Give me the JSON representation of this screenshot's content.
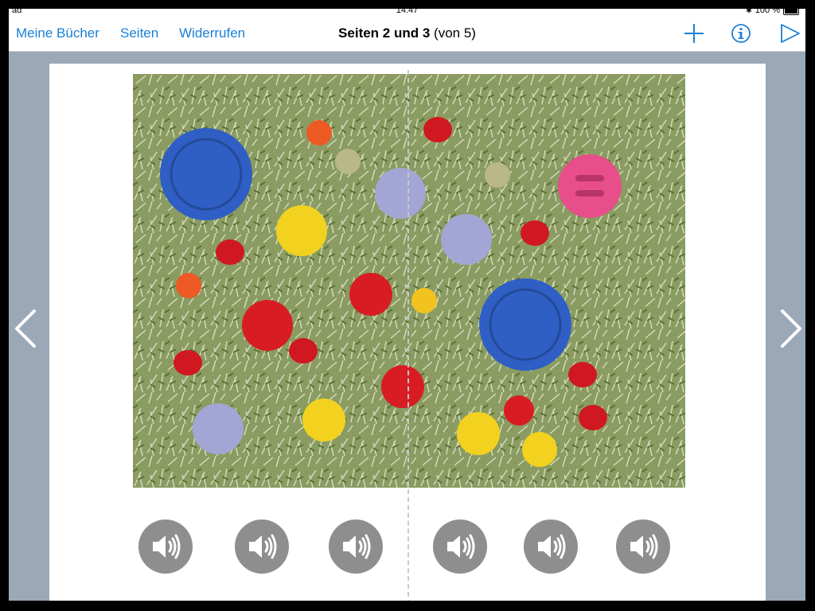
{
  "status": {
    "carrier": "ad",
    "time": "14:47",
    "battery": "100 %"
  },
  "nav": {
    "my_books": "Meine Bücher",
    "pages": "Seiten",
    "undo": "Widerrufen",
    "title_bold": "Seiten 2 und 3",
    "title_rest": "(von 5)"
  },
  "icons": {
    "add": "plus-icon",
    "info": "info-icon",
    "play": "play-icon",
    "prev": "chevron-left-icon",
    "next": "chevron-right-icon",
    "audio": "speaker-icon"
  },
  "colors": {
    "accent": "#1a7fd6",
    "background": "#9aa8b8",
    "audio_button": "#8e8e8e"
  },
  "audio_buttons": [
    "audio-1",
    "audio-2",
    "audio-3",
    "audio-4",
    "audio-5",
    "audio-6"
  ]
}
